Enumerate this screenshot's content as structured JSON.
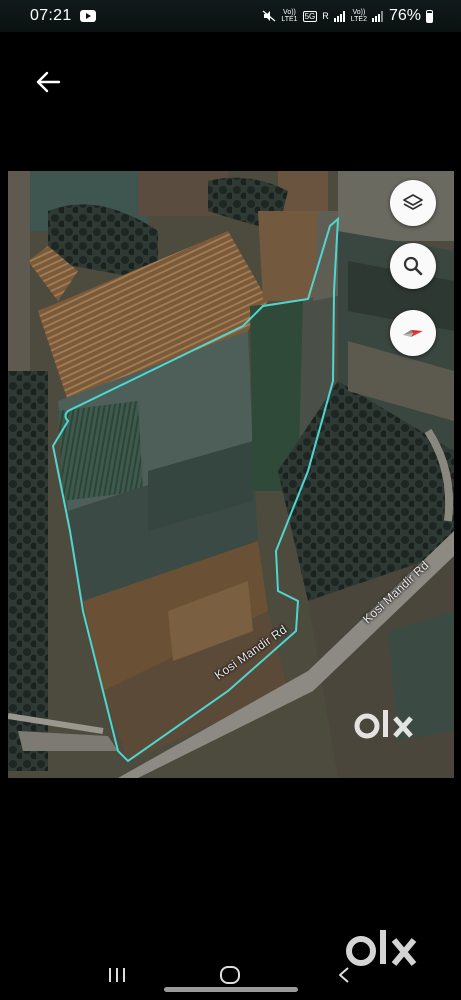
{
  "status_bar": {
    "time": "07:21",
    "network_label_1": "Vo))\nLTE1",
    "network_5g": "5G",
    "network_r": "R",
    "network_label_2": "Vo))\nLTE2",
    "battery_percent": "76%"
  },
  "map": {
    "road_label_1": "Kosi Mandir Rd",
    "road_label_2": "Kosi Mandir Rd",
    "boundary_color": "#4fd6d0",
    "watermark_small": "OLX",
    "controls": {
      "layers_icon": "layers-icon",
      "search_icon": "search-icon",
      "compass_icon": "compass-icon"
    }
  },
  "watermark_large": "OLX",
  "nav": {
    "recents_icon": "recents-icon",
    "home_icon": "home-icon",
    "back_icon": "back-nav-icon"
  }
}
